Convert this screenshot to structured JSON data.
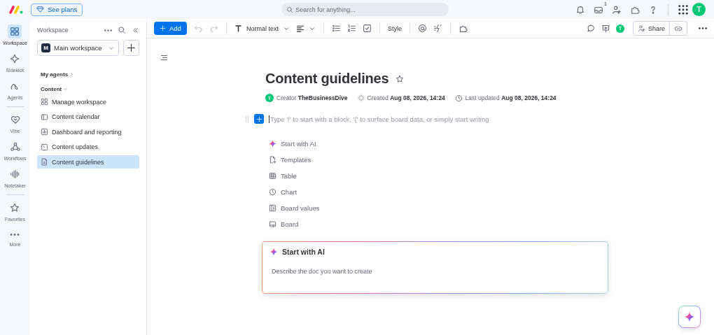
{
  "top_bar": {
    "plans_button": "See plans",
    "search": {
      "placeholder": "Search for anything..."
    },
    "inbox_count": "1",
    "avatar": "T"
  },
  "rail": {
    "groups": [
      {
        "items": [
          {
            "label": "Workspace",
            "selected": true
          },
          {
            "label": "Sidekick",
            "selected": false
          },
          {
            "label": "Agents",
            "selected": false
          }
        ]
      },
      {
        "items": [
          {
            "label": "Vibe",
            "selected": false
          },
          {
            "label": "Workflows",
            "selected": false
          },
          {
            "label": "Notetaker",
            "selected": false
          }
        ]
      },
      {
        "items": [
          {
            "label": "Favorites",
            "selected": false
          },
          {
            "label": "More",
            "selected": false
          }
        ]
      }
    ]
  },
  "sidebar": {
    "title": "Workspace",
    "workspace": {
      "initial": "M",
      "name": "Main workspace"
    },
    "sections": [
      {
        "label": "My agents",
        "expanded": false
      },
      {
        "label": "Content",
        "expanded": true,
        "items": [
          {
            "label": "Manage workspace",
            "selected": false
          },
          {
            "label": "Content calendar",
            "selected": false
          },
          {
            "label": "Dashboard and reporting",
            "selected": false
          },
          {
            "label": "Content updates",
            "selected": false
          },
          {
            "label": "Content guidelines",
            "selected": true
          }
        ]
      }
    ]
  },
  "toolbar": {
    "add_button": "Add",
    "text_style": "Normal text",
    "style_button": "Style",
    "avatar": "T",
    "share_button": "Share"
  },
  "document": {
    "title": "Content guidelines",
    "starred": false,
    "creator_avatar": "T",
    "creator": "Creator **TheBusinessDive**",
    "created": "Created **Aug 08, 2026, 14:24**",
    "updated": "Last updated **Aug 08, 2026, 14:24**",
    "editor": {
      "placeholder": "Type '/' to start with a block, '{' to surface board data, or simply start writing"
    },
    "insert_menu": [
      {
        "label": "Start with AI"
      },
      {
        "label": "Templates"
      },
      {
        "label": "Table"
      },
      {
        "label": "Chart"
      },
      {
        "label": "Board values"
      },
      {
        "label": "Board"
      }
    ],
    "ai_card": {
      "title": "Start with AI",
      "placeholder": "Describe the doc you want to create"
    }
  }
}
